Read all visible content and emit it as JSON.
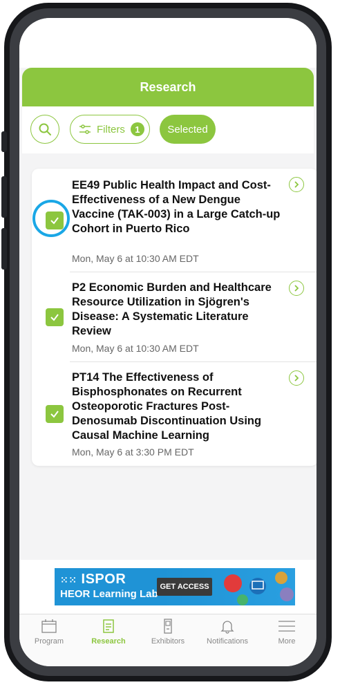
{
  "header": {
    "title": "Research"
  },
  "toolbar": {
    "search_icon": "search-icon",
    "filters_label": "Filters",
    "filters_count": "1",
    "selected_label": "Selected"
  },
  "items": [
    {
      "title": "EE49 Public Health Impact and Cost-Effectiveness of a New Dengue Vaccine (TAK-003) in a Large Catch-up Cohort in Puerto Rico",
      "time": "Mon, May 6 at 10:30 AM EDT",
      "selected": true
    },
    {
      "title": "P2 Economic Burden and Healthcare Resource Utilization in Sjögren's Disease: A Systematic Literature Review",
      "time": "Mon, May 6 at 10:30 AM EDT",
      "selected": true
    },
    {
      "title": "PT14 The Effectiveness of Bisphosphonates on Recurrent Osteoporotic Fractures Post-Denosumab Discontinuation Using Causal Machine Learning",
      "time": "Mon, May 6 at 3:30 PM EDT",
      "selected": true
    }
  ],
  "banner": {
    "logo_text": "ISPOR",
    "subtitle": "HEOR Learning Lab™",
    "cta": "GET ACCESS"
  },
  "tabs": [
    {
      "label": "Program",
      "icon": "calendar-icon",
      "active": false
    },
    {
      "label": "Research",
      "icon": "document-icon",
      "active": true
    },
    {
      "label": "Exhibitors",
      "icon": "booth-icon",
      "active": false
    },
    {
      "label": "Notifications",
      "icon": "bell-icon",
      "active": false
    },
    {
      "label": "More",
      "icon": "menu-icon",
      "active": false
    }
  ],
  "colors": {
    "accent": "#8cc63f",
    "highlight_ring": "#1aa7e6"
  }
}
